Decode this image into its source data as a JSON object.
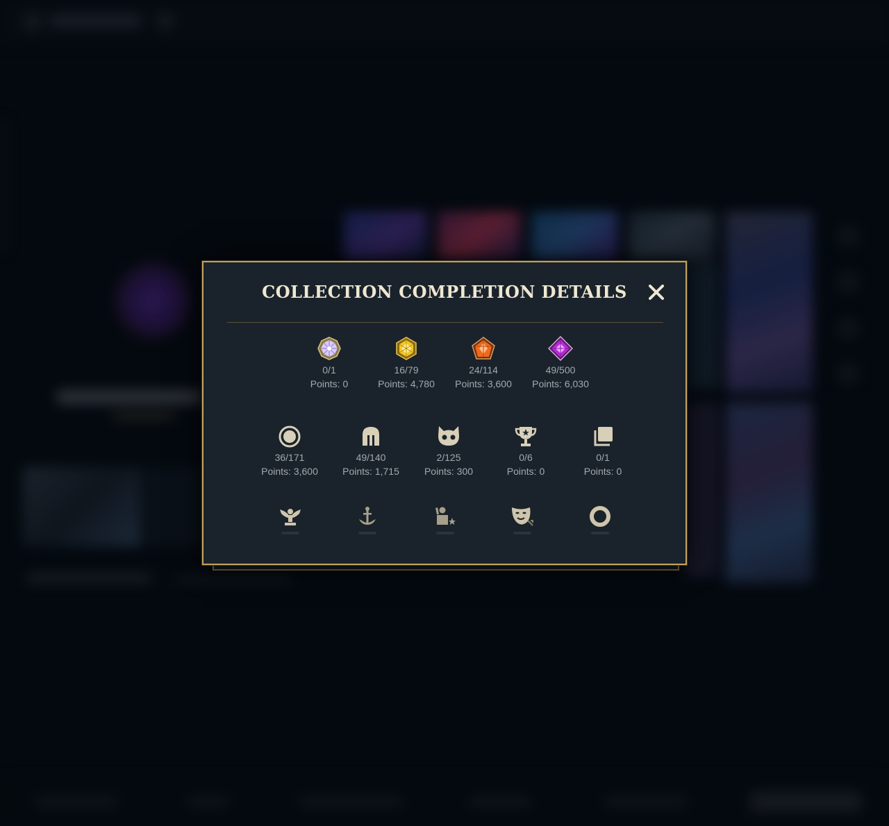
{
  "modal": {
    "title": "COLLECTION COMPLETION DETAILS",
    "close_icon": "close-icon"
  },
  "gems": [
    {
      "icon": "white-gem-icon",
      "count": "0/1",
      "points": "Points: 0",
      "color": "#c8b7f5"
    },
    {
      "icon": "gold-gem-icon",
      "count": "16/79",
      "points": "Points: 4,780",
      "color": "#f0c21a"
    },
    {
      "icon": "orange-gem-icon",
      "count": "24/114",
      "points": "Points: 3,600",
      "color": "#f06a1a"
    },
    {
      "icon": "purple-gem-icon",
      "count": "49/500",
      "points": "Points: 6,030",
      "color": "#b82ad8"
    }
  ],
  "categories": [
    {
      "icon": "circle-icon",
      "count": "36/171",
      "points": "Points: 3,600"
    },
    {
      "icon": "helmet-icon",
      "count": "49/140",
      "points": "Points: 1,715"
    },
    {
      "icon": "pet-icon",
      "count": "2/125",
      "points": "Points: 300"
    },
    {
      "icon": "trophy-icon",
      "count": "0/6",
      "points": "Points: 0"
    },
    {
      "icon": "cards-icon",
      "count": "0/1",
      "points": "Points: 0"
    }
  ],
  "faded_icons": [
    "statue-icon",
    "ward-icon",
    "emote-icon",
    "mask-icon",
    "ring-icon"
  ],
  "colors": {
    "accent": "#c2a35c",
    "panel": "#1a232b",
    "text": "#a2a9ae",
    "title": "#efe7d2"
  }
}
